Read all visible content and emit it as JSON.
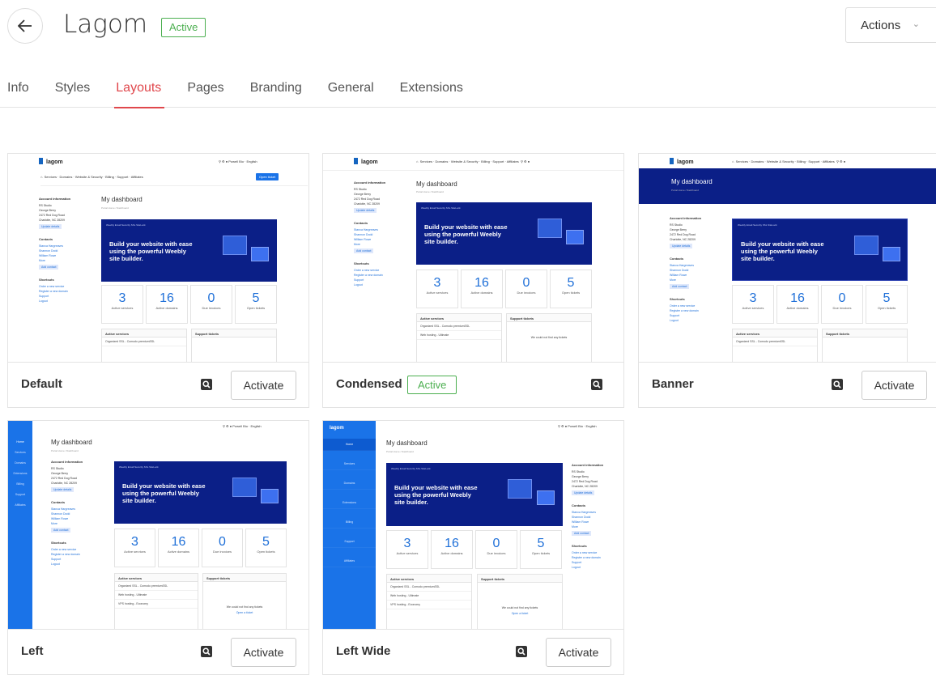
{
  "header": {
    "title": "Lagom",
    "status": "Active",
    "actions_label": "Actions"
  },
  "tabs": [
    {
      "label": "Info"
    },
    {
      "label": "Styles"
    },
    {
      "label": "Layouts",
      "active": true
    },
    {
      "label": "Pages"
    },
    {
      "label": "Branding"
    },
    {
      "label": "General"
    },
    {
      "label": "Extensions"
    }
  ],
  "layouts": [
    {
      "name": "Default",
      "active": false,
      "action": "Activate"
    },
    {
      "name": "Condensed",
      "active": true,
      "badge": "Active"
    },
    {
      "name": "Banner",
      "active": false,
      "action": "Activate"
    },
    {
      "name": "Left",
      "active": false,
      "action": "Activate"
    },
    {
      "name": "Left Wide",
      "active": false,
      "action": "Activate"
    }
  ],
  "preview": {
    "logo": "lagom",
    "nav": [
      "Services",
      "Domains",
      "Website & Security",
      "Billing",
      "Support",
      "Affiliates"
    ],
    "order_btn": "Open ticket",
    "dashboard_title": "My dashboard",
    "breadcrumb": "Portal Home / Dashboard",
    "banner_tabs": "Weebly   Email Security   SSL   SiteLock",
    "banner_line1": "Build your website with ease",
    "banner_line2": "using the powerful Weebly",
    "banner_line3": "site builder.",
    "stats": [
      {
        "value": "3",
        "label": "Active services"
      },
      {
        "value": "16",
        "label": "Active domains"
      },
      {
        "value": "0",
        "label": "Due invoices"
      },
      {
        "value": "5",
        "label": "Open tickets"
      }
    ],
    "account_heading": "Account information",
    "account_name": "RS Studio",
    "account_addr1": "George Berry",
    "account_addr2": "2472 Red Dog Road",
    "account_addr3": "Charlotte, NC 28209",
    "update_btn": "Update details",
    "contacts_heading": "Contacts",
    "contacts": [
      "Stanca Hargreaves",
      "Shannon Dodd",
      "William Rowe",
      "More"
    ],
    "add_contact": "Add contact",
    "shortcuts_heading": "Shortcuts",
    "shortcuts": [
      "Order a new service",
      "Register a new domain",
      "Support",
      "Logout"
    ],
    "active_services": "Active services",
    "support_tickets": "Support tickets",
    "service_rows": [
      "Organized SSL - Comodo premiumSSL",
      "Web hosting - Ultimate",
      "VPS hosting - Economy"
    ],
    "no_tickets": "We could not find any tickets",
    "open_ticket": "Open a ticket",
    "rail_items": [
      "Home",
      "Services",
      "Domains",
      "Extensions",
      "Billing",
      "Support",
      "Affiliates"
    ]
  }
}
